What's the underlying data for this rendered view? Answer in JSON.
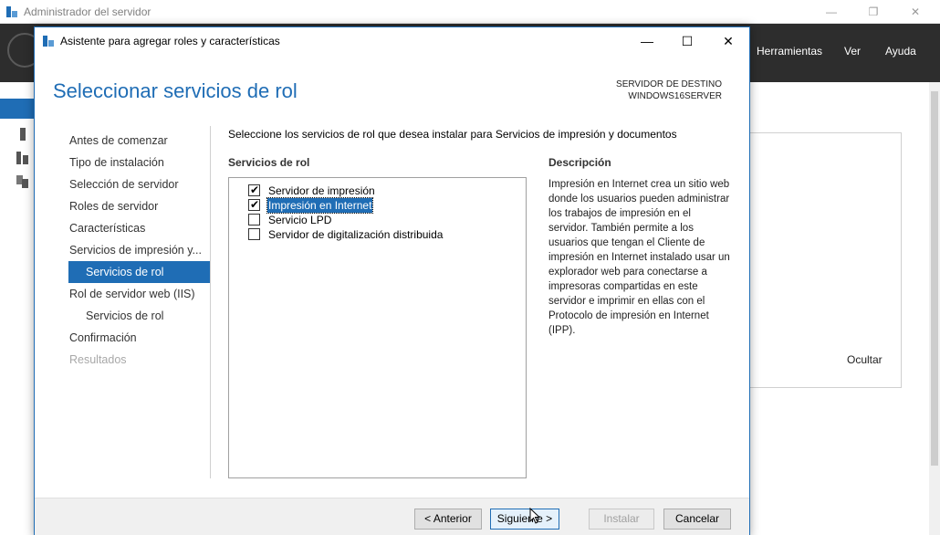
{
  "server_manager": {
    "title": "Administrador del servidor",
    "menu": [
      "Herramientas",
      "Ver",
      "Ayuda"
    ],
    "hide_label": "Ocultar",
    "window_controls": [
      "minimize-icon",
      "maximize-icon",
      "close-icon"
    ]
  },
  "wizard": {
    "title": "Asistente para agregar roles y características",
    "heading": "Seleccionar servicios de rol",
    "target_label": "SERVIDOR DE DESTINO",
    "target_server": "WINDOWS16SERVER",
    "steps": [
      {
        "label": "Antes de comenzar",
        "state": "normal"
      },
      {
        "label": "Tipo de instalación",
        "state": "normal"
      },
      {
        "label": "Selección de servidor",
        "state": "normal"
      },
      {
        "label": "Roles de servidor",
        "state": "normal"
      },
      {
        "label": "Características",
        "state": "normal"
      },
      {
        "label": "Servicios de impresión y...",
        "state": "normal"
      },
      {
        "label": "Servicios de rol",
        "state": "active"
      },
      {
        "label": "Rol de servidor web (IIS)",
        "state": "normal"
      },
      {
        "label": "Servicios de rol",
        "state": "sub"
      },
      {
        "label": "Confirmación",
        "state": "normal"
      },
      {
        "label": "Resultados",
        "state": "disabled"
      }
    ],
    "intro": "Seleccione los servicios de rol que desea instalar para Servicios de impresión y documentos",
    "services_label": "Servicios de rol",
    "services": [
      {
        "label": "Servidor de impresión",
        "checked": true,
        "selected": false
      },
      {
        "label": "Impresión en Internet",
        "checked": true,
        "selected": true
      },
      {
        "label": "Servicio LPD",
        "checked": false,
        "selected": false
      },
      {
        "label": "Servidor de digitalización distribuida",
        "checked": false,
        "selected": false
      }
    ],
    "description_label": "Descripción",
    "description": "Impresión en Internet crea un sitio web donde los usuarios pueden administrar los trabajos de impresión en el servidor. También permite a los usuarios que tengan el Cliente de impresión en Internet instalado usar un explorador web para conectarse a impresoras compartidas en este servidor e imprimir en ellas con el Protocolo de impresión en Internet (IPP).",
    "buttons": {
      "previous": "< Anterior",
      "next": "Siguiente >",
      "install": "Instalar",
      "cancel": "Cancelar"
    }
  },
  "colors": {
    "accent": "#1f6db5",
    "header_bg": "#2d2d2d"
  }
}
